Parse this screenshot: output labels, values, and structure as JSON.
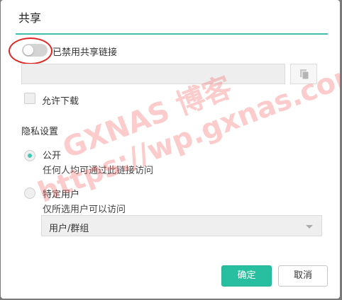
{
  "dialog": {
    "title": "共享",
    "share_toggle_label": "已禁用共享链接",
    "share_toggle_on": false,
    "allow_download_label": "允许下载",
    "allow_download_checked": false,
    "privacy_title": "隐私设置",
    "options": [
      {
        "label": "公开",
        "description": "任何人均可通过此链接访问",
        "selected": true
      },
      {
        "label": "特定用户",
        "description": "仅所选用户可以访问",
        "selected": false
      }
    ],
    "user_group_select": {
      "value": "用户/群组"
    },
    "ok_label": "确定",
    "cancel_label": "取消"
  },
  "watermark": {
    "line1": "GXNAS 博客",
    "line2": "https://wp.gxnas.com"
  },
  "colors": {
    "accent": "#28bfa0",
    "title_underline": "#3cbfae",
    "annotation": "#e32522",
    "watermark": "#f66e6e"
  },
  "icons": {
    "copy": "copy-icon",
    "dropdown": "caret-down-icon"
  }
}
